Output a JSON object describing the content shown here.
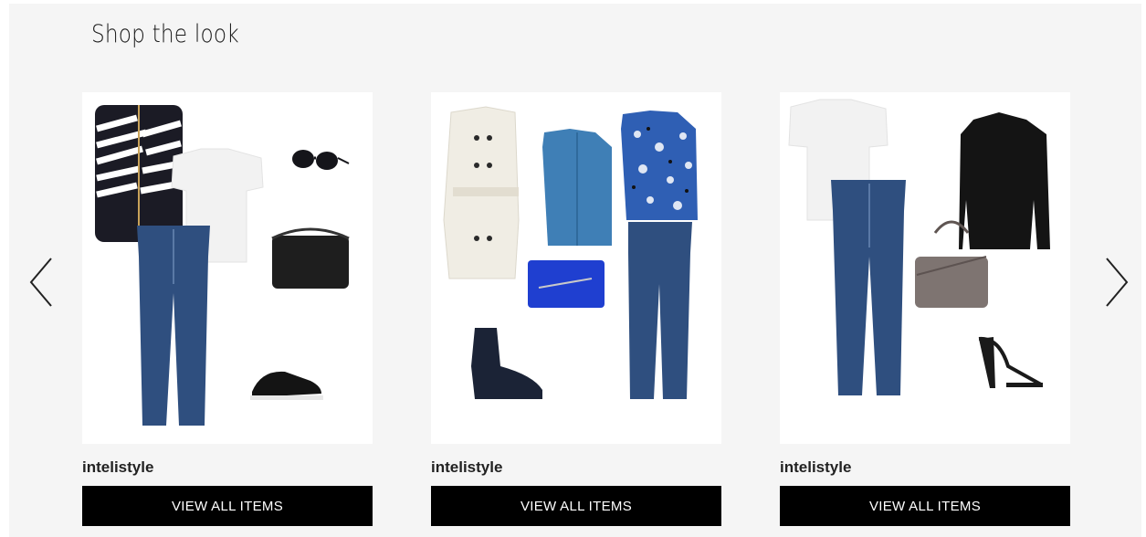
{
  "section": {
    "title": "Shop the look"
  },
  "carousel": {
    "prev_icon": "chevron-left-icon",
    "next_icon": "chevron-right-icon",
    "looks": [
      {
        "brand": "intelistyle",
        "button_label": "VIEW ALL ITEMS"
      },
      {
        "brand": "intelistyle",
        "button_label": "VIEW ALL ITEMS"
      },
      {
        "brand": "intelistyle",
        "button_label": "VIEW ALL ITEMS"
      }
    ]
  },
  "colors": {
    "button_bg": "#000000",
    "button_text": "#ffffff",
    "panel_bg": "#f5f5f5",
    "denim": "#2f4f7f"
  }
}
